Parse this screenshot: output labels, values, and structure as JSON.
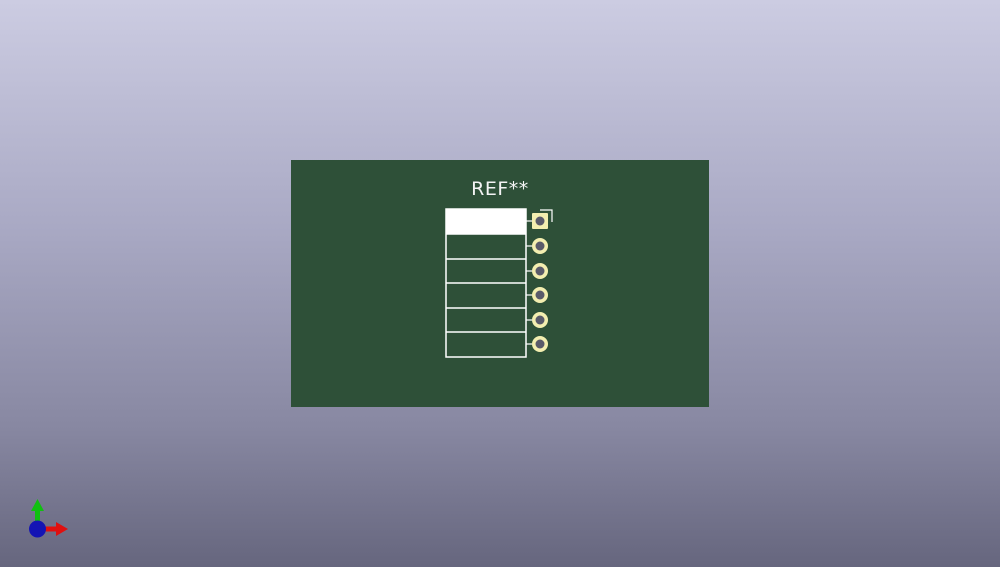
{
  "viewer": {
    "background_top": "#cccce2",
    "background_bottom": "#66667e"
  },
  "board": {
    "color": "#2e5038",
    "reference": "REF**",
    "pin_count": 6,
    "silkscreen_color": "#ffffff",
    "pad_color": "#f3eeb0",
    "first_pad_shape": "square",
    "other_pad_shape": "round"
  },
  "axis_indicator": {
    "x_color": "#e01010",
    "y_color": "#10c010",
    "z_color": "#1010c0",
    "icons": [
      "x-axis-arrow-icon",
      "y-axis-arrow-icon",
      "z-axis-dot-icon"
    ]
  }
}
